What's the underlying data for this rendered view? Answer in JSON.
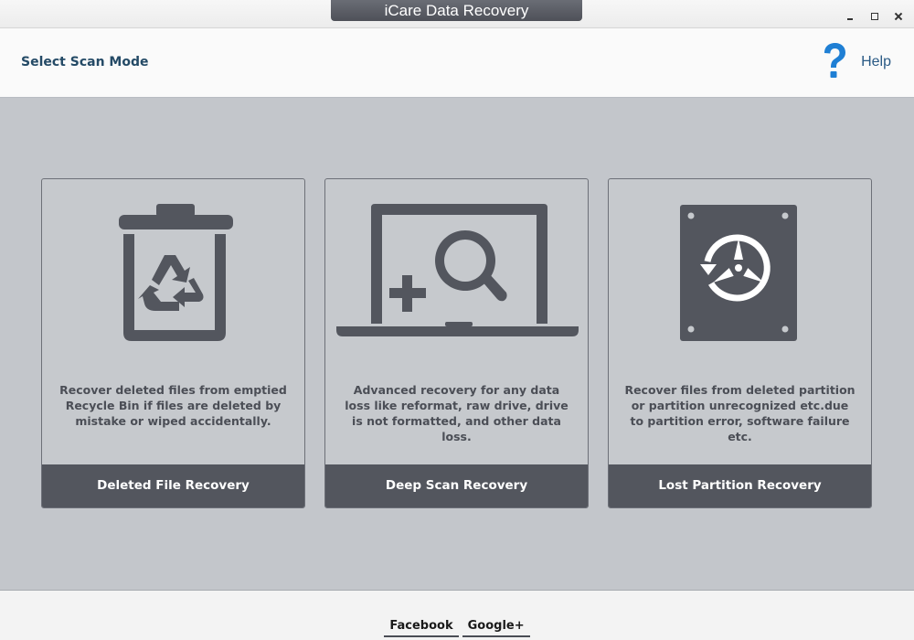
{
  "window": {
    "title": "iCare Data Recovery",
    "controls": [
      "minimize-icon",
      "maximize-icon",
      "close-icon"
    ]
  },
  "header": {
    "title": "Select Scan Mode",
    "help_label": "Help",
    "help_icon": "question-mark-icon"
  },
  "modes": [
    {
      "icon": "recycle-bin-icon",
      "description": "Recover deleted files from emptied Recycle Bin if files are deleted by mistake or wiped accidentally.",
      "label": "Deleted File Recovery"
    },
    {
      "icon": "laptop-search-icon",
      "description": "Advanced recovery for any data loss like reformat, raw drive, drive is not formatted, and other data loss.",
      "label": "Deep Scan Recovery"
    },
    {
      "icon": "hard-drive-restore-icon",
      "description": "Recover files from deleted partition or partition unrecognized etc.due to partition error, software failure etc.",
      "label": "Lost Partition Recovery"
    }
  ],
  "footer": {
    "facebook_label": "Facebook",
    "googleplus_label": "Google+"
  },
  "colors": {
    "title_tab": "#55585f",
    "main_bg": "#c3c6cb",
    "card_footer": "#53565e",
    "icon": "#53565e",
    "accent_blue": "#1f7fd4"
  }
}
